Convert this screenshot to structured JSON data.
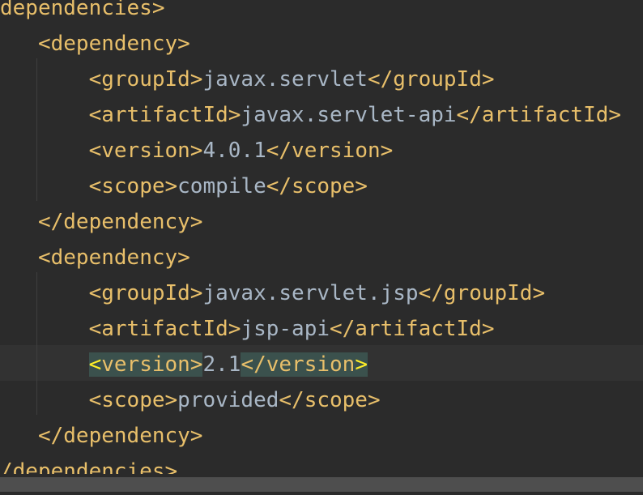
{
  "editor": {
    "language": "xml",
    "current_line_index": 10,
    "lines": [
      {
        "indent": "",
        "parts": [
          {
            "t": "dependencies>",
            "c": "tag"
          }
        ]
      },
      {
        "indent": "   ",
        "parts": [
          {
            "t": "<dependency>",
            "c": "tag"
          }
        ]
      },
      {
        "indent": "       ",
        "parts": [
          {
            "t": "<groupId>",
            "c": "tag"
          },
          {
            "t": "javax.servlet",
            "c": "text"
          },
          {
            "t": "</groupId>",
            "c": "tag"
          }
        ]
      },
      {
        "indent": "       ",
        "parts": [
          {
            "t": "<artifactId>",
            "c": "tag"
          },
          {
            "t": "javax.servlet-api",
            "c": "text"
          },
          {
            "t": "</artifactId>",
            "c": "tag"
          }
        ]
      },
      {
        "indent": "       ",
        "parts": [
          {
            "t": "<version>",
            "c": "tag"
          },
          {
            "t": "4.0.1",
            "c": "text"
          },
          {
            "t": "</version>",
            "c": "tag"
          }
        ]
      },
      {
        "indent": "       ",
        "parts": [
          {
            "t": "<scope>",
            "c": "tag"
          },
          {
            "t": "compile",
            "c": "text"
          },
          {
            "t": "</scope>",
            "c": "tag"
          }
        ]
      },
      {
        "indent": "   ",
        "parts": [
          {
            "t": "</dependency>",
            "c": "tag"
          }
        ]
      },
      {
        "indent": "   ",
        "parts": [
          {
            "t": "<dependency>",
            "c": "tag"
          }
        ]
      },
      {
        "indent": "       ",
        "parts": [
          {
            "t": "<groupId>",
            "c": "tag"
          },
          {
            "t": "javax.servlet.jsp",
            "c": "text"
          },
          {
            "t": "</groupId>",
            "c": "tag"
          }
        ]
      },
      {
        "indent": "       ",
        "parts": [
          {
            "t": "<artifactId>",
            "c": "tag"
          },
          {
            "t": "jsp-api",
            "c": "text"
          },
          {
            "t": "</artifactId>",
            "c": "tag"
          }
        ]
      },
      {
        "indent": "       ",
        "parts": [
          {
            "t": "<",
            "c": "tag match match-bracket"
          },
          {
            "t": "version>",
            "c": "tag match"
          },
          {
            "t": "2.1",
            "c": "text"
          },
          {
            "t": "</version",
            "c": "tag match"
          },
          {
            "t": ">",
            "c": "tag match match-bracket"
          }
        ]
      },
      {
        "indent": "       ",
        "parts": [
          {
            "t": "<scope>",
            "c": "tag"
          },
          {
            "t": "provided",
            "c": "text"
          },
          {
            "t": "</scope>",
            "c": "tag"
          }
        ]
      },
      {
        "indent": "   ",
        "parts": [
          {
            "t": "</dependency>",
            "c": "tag"
          }
        ]
      },
      {
        "indent": "",
        "parts": [
          {
            "t": "/dependencies>",
            "c": "tag"
          }
        ]
      }
    ]
  },
  "colors": {
    "background": "#2b2b2b",
    "tag": "#e8bf6a",
    "text": "#a9b7c6",
    "current_line": "#323232",
    "match_highlight": "#3b514d"
  }
}
